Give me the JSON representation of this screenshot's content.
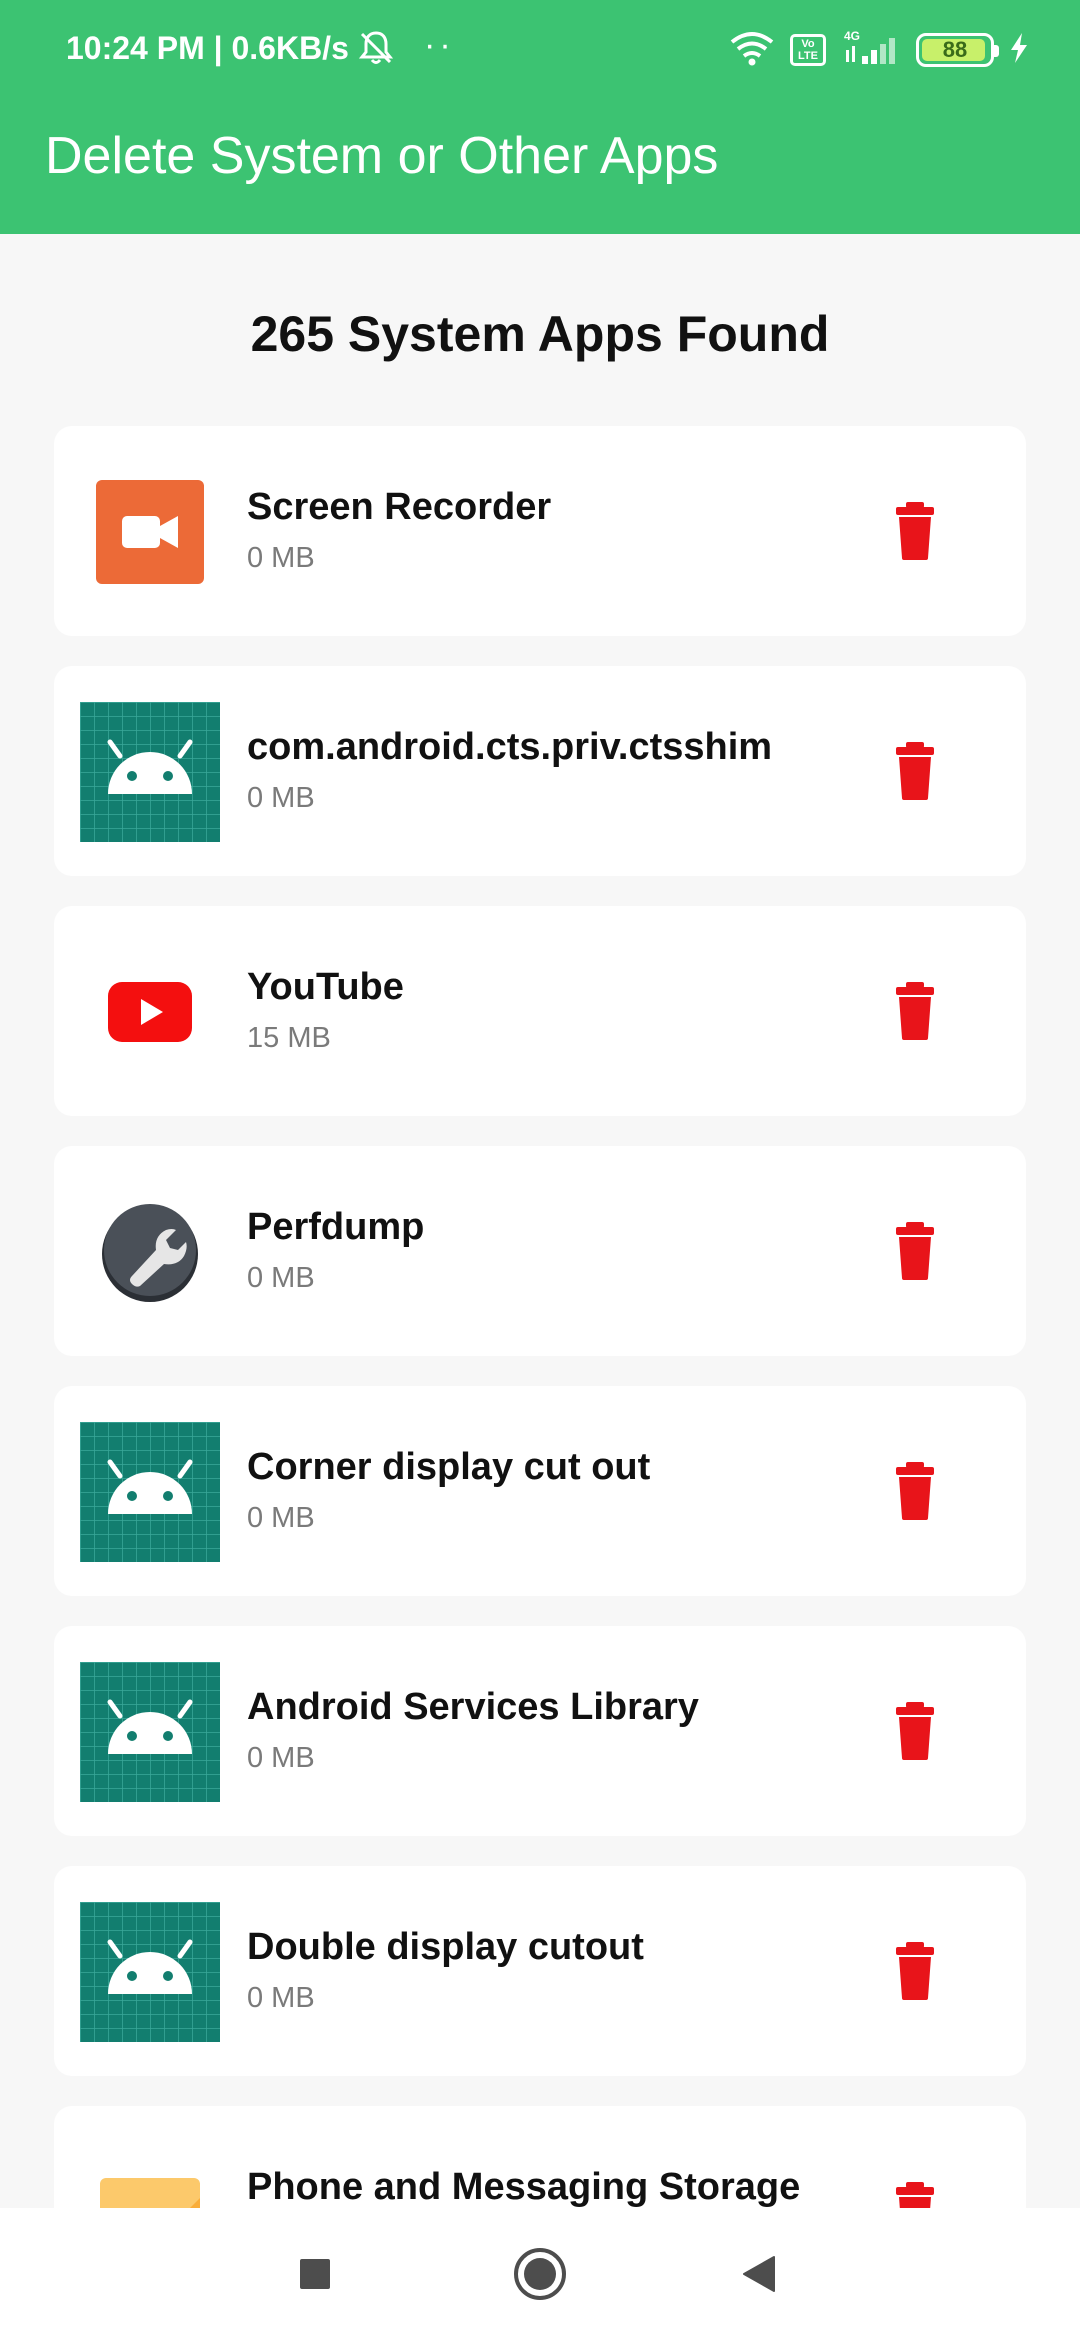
{
  "status_bar": {
    "time": "10:24 PM",
    "separator": " | ",
    "net_rate": "0.6KB/s",
    "dots": "··",
    "volte": "Vo\nLTE",
    "network": "4G",
    "battery_level": "88",
    "icons": [
      "dnd-off-icon",
      "wifi-icon",
      "volte-icon",
      "signal-icon",
      "battery-icon",
      "charging-icon"
    ]
  },
  "app_bar": {
    "title": "Delete System or Other Apps",
    "background_color": "#3cc372"
  },
  "heading": "265 System Apps Found",
  "apps": [
    {
      "name": "Screen Recorder",
      "size": "0 MB",
      "icon": "screen-recorder-icon"
    },
    {
      "name": "com.android.cts.priv.ctsshim",
      "size": "0 MB",
      "icon": "android-default-icon"
    },
    {
      "name": "YouTube",
      "size": "15 MB",
      "icon": "youtube-icon"
    },
    {
      "name": "Perfdump",
      "size": "0 MB",
      "icon": "wrench-icon"
    },
    {
      "name": "Corner display cut out",
      "size": "0 MB",
      "icon": "android-default-icon"
    },
    {
      "name": "Android Services Library",
      "size": "0 MB",
      "icon": "android-default-icon"
    },
    {
      "name": "Double display cutout",
      "size": "0 MB",
      "icon": "android-default-icon"
    },
    {
      "name": "Phone and Messaging Storage",
      "size": "",
      "icon": "folder-icon"
    }
  ],
  "delete_icon": "trash-icon",
  "delete_color": "#e8141a",
  "nav_bar": {
    "buttons": [
      "recents-square-icon",
      "home-circle-icon",
      "back-triangle-icon"
    ]
  }
}
